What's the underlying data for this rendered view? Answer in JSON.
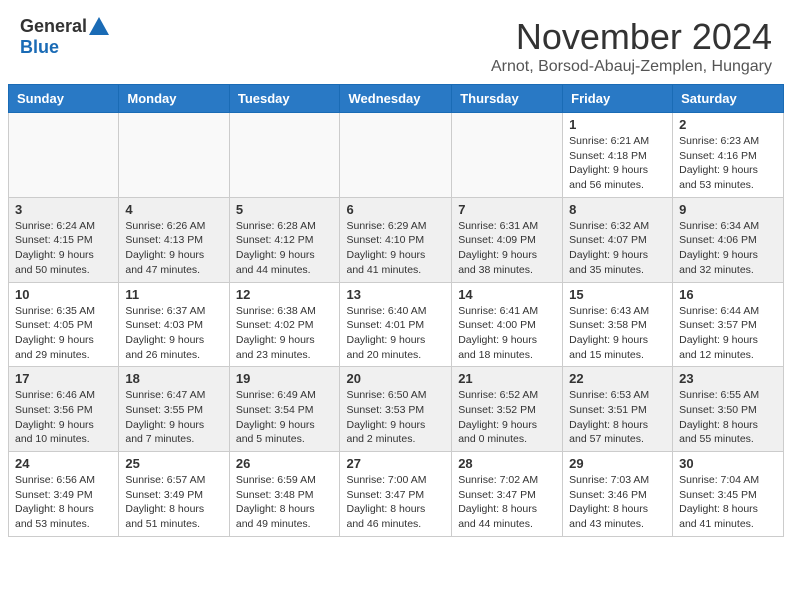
{
  "header": {
    "logo_general": "General",
    "logo_blue": "Blue",
    "month_title": "November 2024",
    "subtitle": "Arnot, Borsod-Abauj-Zemplen, Hungary"
  },
  "weekdays": [
    "Sunday",
    "Monday",
    "Tuesday",
    "Wednesday",
    "Thursday",
    "Friday",
    "Saturday"
  ],
  "weeks": [
    [
      {
        "day": "",
        "info": ""
      },
      {
        "day": "",
        "info": ""
      },
      {
        "day": "",
        "info": ""
      },
      {
        "day": "",
        "info": ""
      },
      {
        "day": "",
        "info": ""
      },
      {
        "day": "1",
        "info": "Sunrise: 6:21 AM\nSunset: 4:18 PM\nDaylight: 9 hours\nand 56 minutes."
      },
      {
        "day": "2",
        "info": "Sunrise: 6:23 AM\nSunset: 4:16 PM\nDaylight: 9 hours\nand 53 minutes."
      }
    ],
    [
      {
        "day": "3",
        "info": "Sunrise: 6:24 AM\nSunset: 4:15 PM\nDaylight: 9 hours\nand 50 minutes."
      },
      {
        "day": "4",
        "info": "Sunrise: 6:26 AM\nSunset: 4:13 PM\nDaylight: 9 hours\nand 47 minutes."
      },
      {
        "day": "5",
        "info": "Sunrise: 6:28 AM\nSunset: 4:12 PM\nDaylight: 9 hours\nand 44 minutes."
      },
      {
        "day": "6",
        "info": "Sunrise: 6:29 AM\nSunset: 4:10 PM\nDaylight: 9 hours\nand 41 minutes."
      },
      {
        "day": "7",
        "info": "Sunrise: 6:31 AM\nSunset: 4:09 PM\nDaylight: 9 hours\nand 38 minutes."
      },
      {
        "day": "8",
        "info": "Sunrise: 6:32 AM\nSunset: 4:07 PM\nDaylight: 9 hours\nand 35 minutes."
      },
      {
        "day": "9",
        "info": "Sunrise: 6:34 AM\nSunset: 4:06 PM\nDaylight: 9 hours\nand 32 minutes."
      }
    ],
    [
      {
        "day": "10",
        "info": "Sunrise: 6:35 AM\nSunset: 4:05 PM\nDaylight: 9 hours\nand 29 minutes."
      },
      {
        "day": "11",
        "info": "Sunrise: 6:37 AM\nSunset: 4:03 PM\nDaylight: 9 hours\nand 26 minutes."
      },
      {
        "day": "12",
        "info": "Sunrise: 6:38 AM\nSunset: 4:02 PM\nDaylight: 9 hours\nand 23 minutes."
      },
      {
        "day": "13",
        "info": "Sunrise: 6:40 AM\nSunset: 4:01 PM\nDaylight: 9 hours\nand 20 minutes."
      },
      {
        "day": "14",
        "info": "Sunrise: 6:41 AM\nSunset: 4:00 PM\nDaylight: 9 hours\nand 18 minutes."
      },
      {
        "day": "15",
        "info": "Sunrise: 6:43 AM\nSunset: 3:58 PM\nDaylight: 9 hours\nand 15 minutes."
      },
      {
        "day": "16",
        "info": "Sunrise: 6:44 AM\nSunset: 3:57 PM\nDaylight: 9 hours\nand 12 minutes."
      }
    ],
    [
      {
        "day": "17",
        "info": "Sunrise: 6:46 AM\nSunset: 3:56 PM\nDaylight: 9 hours\nand 10 minutes."
      },
      {
        "day": "18",
        "info": "Sunrise: 6:47 AM\nSunset: 3:55 PM\nDaylight: 9 hours\nand 7 minutes."
      },
      {
        "day": "19",
        "info": "Sunrise: 6:49 AM\nSunset: 3:54 PM\nDaylight: 9 hours\nand 5 minutes."
      },
      {
        "day": "20",
        "info": "Sunrise: 6:50 AM\nSunset: 3:53 PM\nDaylight: 9 hours\nand 2 minutes."
      },
      {
        "day": "21",
        "info": "Sunrise: 6:52 AM\nSunset: 3:52 PM\nDaylight: 9 hours\nand 0 minutes."
      },
      {
        "day": "22",
        "info": "Sunrise: 6:53 AM\nSunset: 3:51 PM\nDaylight: 8 hours\nand 57 minutes."
      },
      {
        "day": "23",
        "info": "Sunrise: 6:55 AM\nSunset: 3:50 PM\nDaylight: 8 hours\nand 55 minutes."
      }
    ],
    [
      {
        "day": "24",
        "info": "Sunrise: 6:56 AM\nSunset: 3:49 PM\nDaylight: 8 hours\nand 53 minutes."
      },
      {
        "day": "25",
        "info": "Sunrise: 6:57 AM\nSunset: 3:49 PM\nDaylight: 8 hours\nand 51 minutes."
      },
      {
        "day": "26",
        "info": "Sunrise: 6:59 AM\nSunset: 3:48 PM\nDaylight: 8 hours\nand 49 minutes."
      },
      {
        "day": "27",
        "info": "Sunrise: 7:00 AM\nSunset: 3:47 PM\nDaylight: 8 hours\nand 46 minutes."
      },
      {
        "day": "28",
        "info": "Sunrise: 7:02 AM\nSunset: 3:47 PM\nDaylight: 8 hours\nand 44 minutes."
      },
      {
        "day": "29",
        "info": "Sunrise: 7:03 AM\nSunset: 3:46 PM\nDaylight: 8 hours\nand 43 minutes."
      },
      {
        "day": "30",
        "info": "Sunrise: 7:04 AM\nSunset: 3:45 PM\nDaylight: 8 hours\nand 41 minutes."
      }
    ]
  ]
}
